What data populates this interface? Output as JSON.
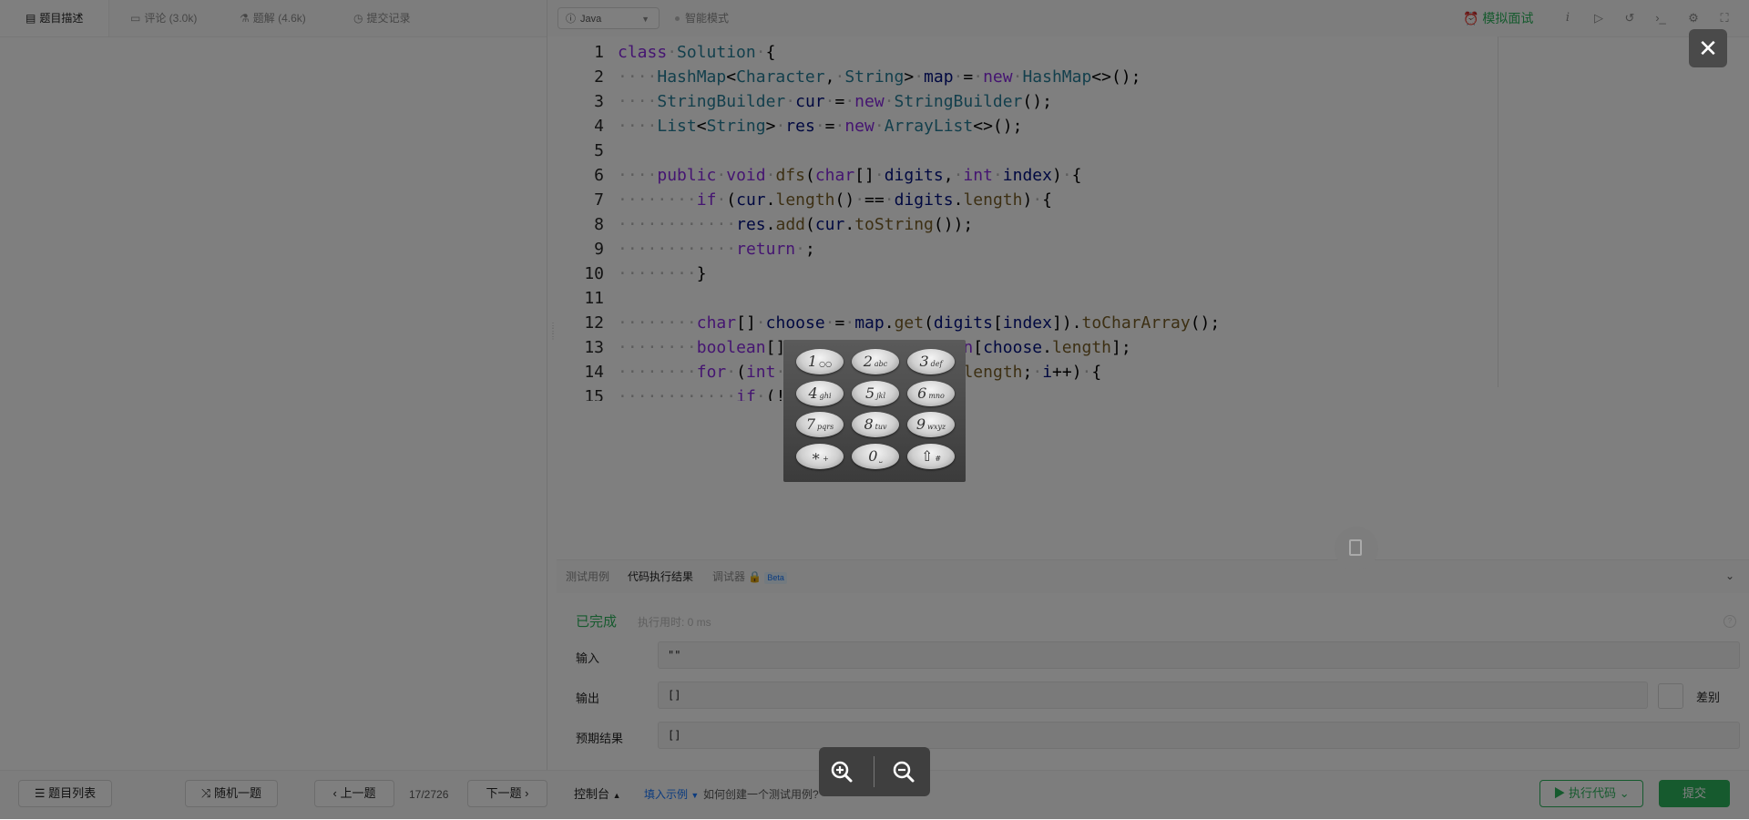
{
  "left_tabs": [
    {
      "label": "题目描述",
      "icon": "description-icon"
    },
    {
      "label": "评论 (3.0k)",
      "icon": "comment-icon"
    },
    {
      "label": "题解 (4.6k)",
      "icon": "solution-icon"
    },
    {
      "label": "提交记录",
      "icon": "history-icon"
    }
  ],
  "editor": {
    "language": "Java",
    "smart_mode": "智能模式",
    "mock_interview": "模拟面试",
    "code_lines": [
      "class·Solution·{",
      "····HashMap<Character,·String>·map·=·new·HashMap<>();",
      "····StringBuilder·cur·=·new·StringBuilder();",
      "····List<String>·res·=·new·ArrayList<>();",
      "",
      "····public·void·dfs(char[]·digits,·int·index)·{",
      "········if·(cur.length()·==·digits.length)·{",
      "············res.add(cur.toString());",
      "············return·;",
      "········}",
      "",
      "········char[]·choose·=·map.get(digits[index]).toCharArray();",
      "········boolean[]·used·=·new·boolean[choose.length];",
      "········for·(int·i·=·0;·i·<·choose.length;·i++)·{",
      "············if·(!used[i])·{"
    ]
  },
  "result_panel": {
    "tabs": [
      "测试用例",
      "代码执行结果",
      "调试器"
    ],
    "beta": "Beta",
    "status": "已完成",
    "runtime": "执行用时: 0 ms",
    "input_label": "输入",
    "input_value": "\"\"",
    "output_label": "输出",
    "output_value": "[]",
    "expected_label": "预期结果",
    "expected_value": "[]",
    "diff_label": "差别"
  },
  "footer": {
    "problem_list": "题目列表",
    "random": "随机一题",
    "prev": "上一题",
    "pager": "17/2726",
    "next": "下一题",
    "console": "控制台",
    "fill_example": "填入示例",
    "how_to": "如何创建一个测试用例?",
    "run_code": "执行代码",
    "submit": "提交"
  },
  "overlay": {
    "close": "✕",
    "keypad": [
      {
        "digit": "1",
        "letters": "○○"
      },
      {
        "digit": "2",
        "letters": "abc"
      },
      {
        "digit": "3",
        "letters": "def"
      },
      {
        "digit": "4",
        "letters": "ghi"
      },
      {
        "digit": "5",
        "letters": "jkl"
      },
      {
        "digit": "6",
        "letters": "mno"
      },
      {
        "digit": "7",
        "letters": "pqrs"
      },
      {
        "digit": "8",
        "letters": "tuv"
      },
      {
        "digit": "9",
        "letters": "wxyz"
      },
      {
        "digit": "∗",
        "letters": "+"
      },
      {
        "digit": "0",
        "letters": "⎵"
      },
      {
        "digit": "⇧",
        "letters": "#"
      }
    ]
  },
  "colors": {
    "accent_green": "#2db55d",
    "link_blue": "#1677ff",
    "overlay": "rgba(0,0,0,0.5)"
  }
}
